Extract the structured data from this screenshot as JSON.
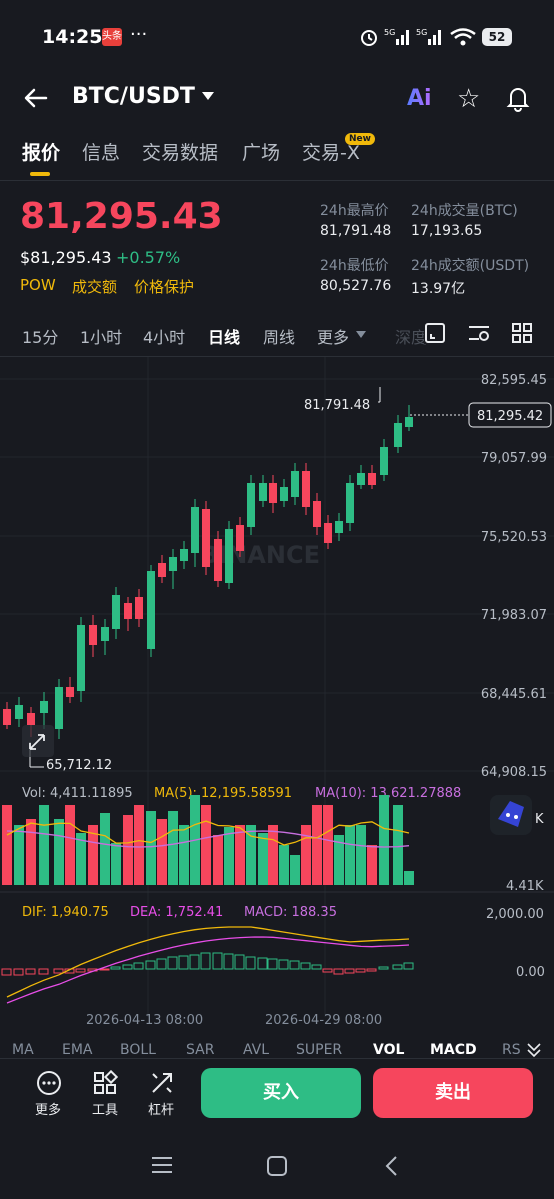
{
  "status_bar": {
    "time": "14:25",
    "news_badge": "头条",
    "dots": "···",
    "signal": "5G 5G",
    "battery": "52"
  },
  "header": {
    "pair": "BTC/USDT",
    "ai_label": "Ai"
  },
  "tabs": [
    "报价",
    "信息",
    "交易数据",
    "广场",
    "交易-X"
  ],
  "new_badge": "New",
  "price": {
    "last": "81,295.43",
    "usd": "$81,295.43",
    "change": "+0.57%",
    "tags": [
      "POW",
      "成交额",
      "价格保护"
    ],
    "stats": {
      "high_label": "24h最高价",
      "high": "81,791.48",
      "vol_btc_label": "24h成交量(BTC)",
      "vol_btc": "17,193.65",
      "low_label": "24h最低价",
      "low": "80,527.76",
      "vol_usdt_label": "24h成交额(USDT)",
      "vol_usdt": "13.97亿"
    }
  },
  "intervals": [
    "15分",
    "1小时",
    "4小时",
    "日线",
    "周线",
    "更多",
    "深度"
  ],
  "chart": {
    "watermark": "BINANCE",
    "y_ticks": [
      "82,595.45",
      "79,057.99",
      "75,520.53",
      "71,983.07",
      "68,445.61",
      "64,908.15"
    ],
    "high_marker": "81,791.48",
    "low_marker": "65,712.12",
    "last_marker": "81,295.42",
    "vol_line": {
      "vol": "Vol: 4,411.11895",
      "ma5": "MA(5): 12,195.58591",
      "ma10": "MA(10): 13,621.27888"
    },
    "vol_axis": "4.41K",
    "k_label": "K",
    "macd_line": {
      "dif": "DIF: 1,940.75",
      "dea": "DEA: 1,752.41",
      "macd": "MACD: 188.35"
    },
    "macd_ticks": [
      "2,000.00",
      "0.00"
    ],
    "dates": [
      "2026-04-13 08:00",
      "2026-04-29 08:00"
    ],
    "colors": {
      "up": "#2ebd85",
      "down": "#f6465d",
      "ma5": "#f0b90b",
      "ma10": "#c86fdf"
    }
  },
  "indicators": [
    "MA",
    "EMA",
    "BOLL",
    "SAR",
    "AVL",
    "SUPER",
    "VOL",
    "MACD",
    "RS"
  ],
  "bottom": {
    "more": "更多",
    "tools": "工具",
    "leverage": "杠杆",
    "buy": "买入",
    "sell": "卖出"
  }
}
